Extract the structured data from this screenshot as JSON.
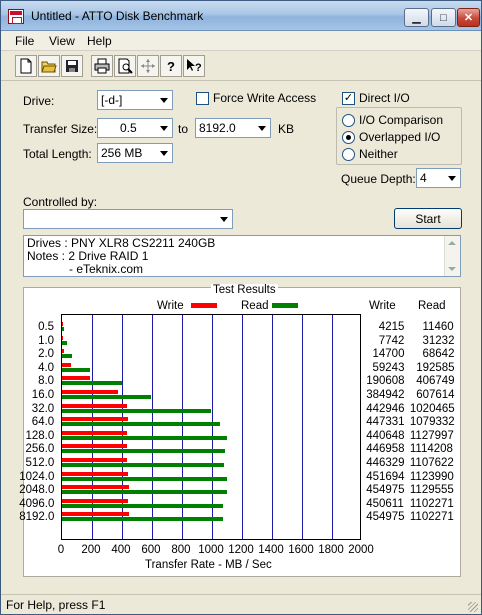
{
  "window": {
    "title": "Untitled - ATTO Disk Benchmark"
  },
  "menu": [
    "File",
    "View",
    "Help"
  ],
  "toolbar_icons": [
    "new-file-icon",
    "open-folder-icon",
    "save-icon",
    "print-icon",
    "print-preview-icon",
    "move-icon",
    "help-icon",
    "whats-this-help-icon"
  ],
  "form": {
    "drive_label": "Drive:",
    "drive_value": "[-d-]",
    "force_write_label": "Force Write Access",
    "force_write_checked": false,
    "direct_io_label": "Direct I/O",
    "direct_io_checked": true,
    "transfer_size_label": "Transfer Size:",
    "transfer_from": "0.5",
    "to_label": "to",
    "transfer_to": "8192.0",
    "kb_label": "KB",
    "total_length_label": "Total Length:",
    "total_length_value": "256 MB",
    "io_options": [
      {
        "label": "I/O Comparison",
        "selected": false
      },
      {
        "label": "Overlapped I/O",
        "selected": true
      },
      {
        "label": "Neither",
        "selected": false
      }
    ],
    "queue_depth_label": "Queue Depth:",
    "queue_depth_value": "4",
    "controlled_by_label": "Controlled by:",
    "controlled_by_value": "",
    "start_label": "Start"
  },
  "notes": {
    "line1": "Drives :  PNY XLR8 CS2211 240GB",
    "line2": "Notes :   2 Drive RAID 1",
    "line3": "- eTeknix.com"
  },
  "results": {
    "title": "Test Results",
    "write_legend": "Write",
    "read_legend": "Read",
    "write_col": "Write",
    "read_col": "Read",
    "colors": {
      "write": "#ff0000",
      "read": "#008000"
    }
  },
  "chart_data": {
    "type": "bar",
    "orientation": "horizontal",
    "categories": [
      "0.5",
      "1.0",
      "2.0",
      "4.0",
      "8.0",
      "16.0",
      "32.0",
      "64.0",
      "128.0",
      "256.0",
      "512.0",
      "1024.0",
      "2048.0",
      "4096.0",
      "8192.0"
    ],
    "series": [
      {
        "name": "Write",
        "values": [
          4215,
          7742,
          14700,
          59243,
          190608,
          384942,
          442946,
          447331,
          440648,
          446958,
          446329,
          451694,
          454975,
          450611,
          454975
        ]
      },
      {
        "name": "Read",
        "values": [
          11460,
          31232,
          68642,
          192585,
          406749,
          607614,
          1020465,
          1079332,
          1127997,
          1114208,
          1107622,
          1123990,
          1129555,
          1102271,
          1102271
        ]
      }
    ],
    "xlabel": "Transfer Rate - MB / Sec",
    "xticks": [
      "0",
      "200",
      "400",
      "600",
      "800",
      "1000",
      "1200",
      "1400",
      "1600",
      "1800",
      "2000"
    ],
    "xlim": [
      0,
      2000
    ],
    "grid": true,
    "legend": "top"
  },
  "status": {
    "text": "For Help, press F1"
  }
}
